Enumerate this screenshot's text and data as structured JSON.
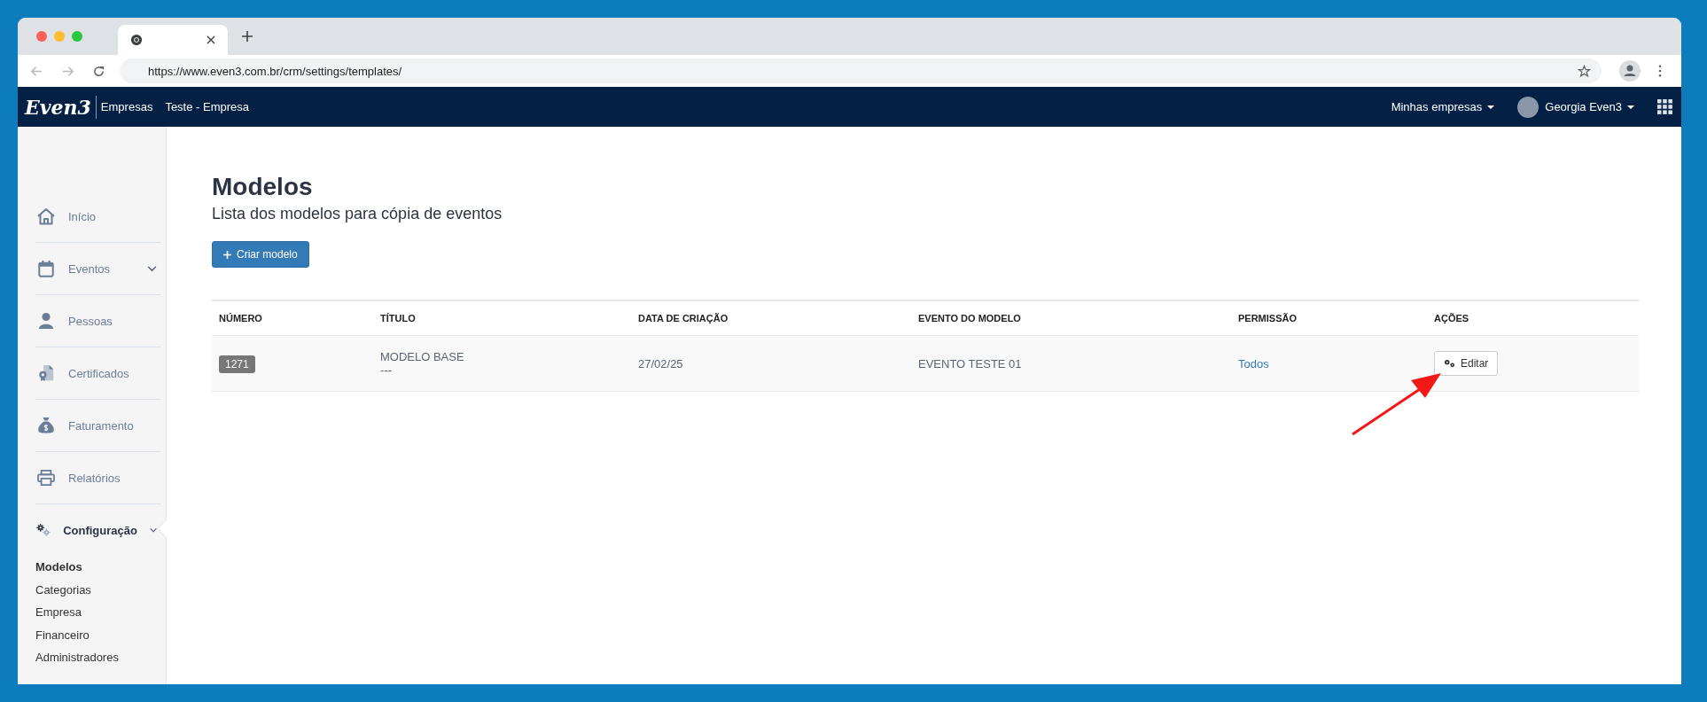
{
  "browser": {
    "url": "https://www.even3.com.br/crm/settings/templates/"
  },
  "navbar": {
    "logo": "Even3",
    "brand_sub": "Empresas",
    "company": "Teste - Empresa",
    "menus": [
      "Minhas empresas",
      "Georgia Even3"
    ]
  },
  "sidebar": {
    "items": [
      {
        "label": "Início",
        "selected": false
      },
      {
        "label": "Eventos",
        "selected": false,
        "expanded": false
      },
      {
        "label": "Pessoas",
        "selected": false
      },
      {
        "label": "Certificados",
        "selected": false
      },
      {
        "label": "Faturamento",
        "selected": false
      },
      {
        "label": "Relatórios",
        "selected": false
      },
      {
        "label": "Configuração",
        "selected": true,
        "expanded": true,
        "children": [
          {
            "label": "Modelos",
            "selected": true
          },
          {
            "label": "Categorias",
            "selected": false
          },
          {
            "label": "Empresa",
            "selected": false
          },
          {
            "label": "Financeiro",
            "selected": false
          },
          {
            "label": "Administradores",
            "selected": false
          }
        ]
      }
    ]
  },
  "page": {
    "title": "Modelos",
    "subtitle": "Lista dos modelos para cópia de eventos",
    "create_button": "Criar modelo"
  },
  "table": {
    "columns": [
      "NÚMERO",
      "TÍTULO",
      "DATA DE CRIAÇÃO",
      "EVENTO DO MODELO",
      "PERMISSÃO",
      "AÇÕES"
    ],
    "rows": [
      {
        "number": "1271",
        "title": "MODELO BASE",
        "title_sub": "---",
        "created": "27/02/25",
        "event": "EVENTO TESTE 01",
        "permission": "Todos",
        "action": "Editar"
      }
    ]
  }
}
